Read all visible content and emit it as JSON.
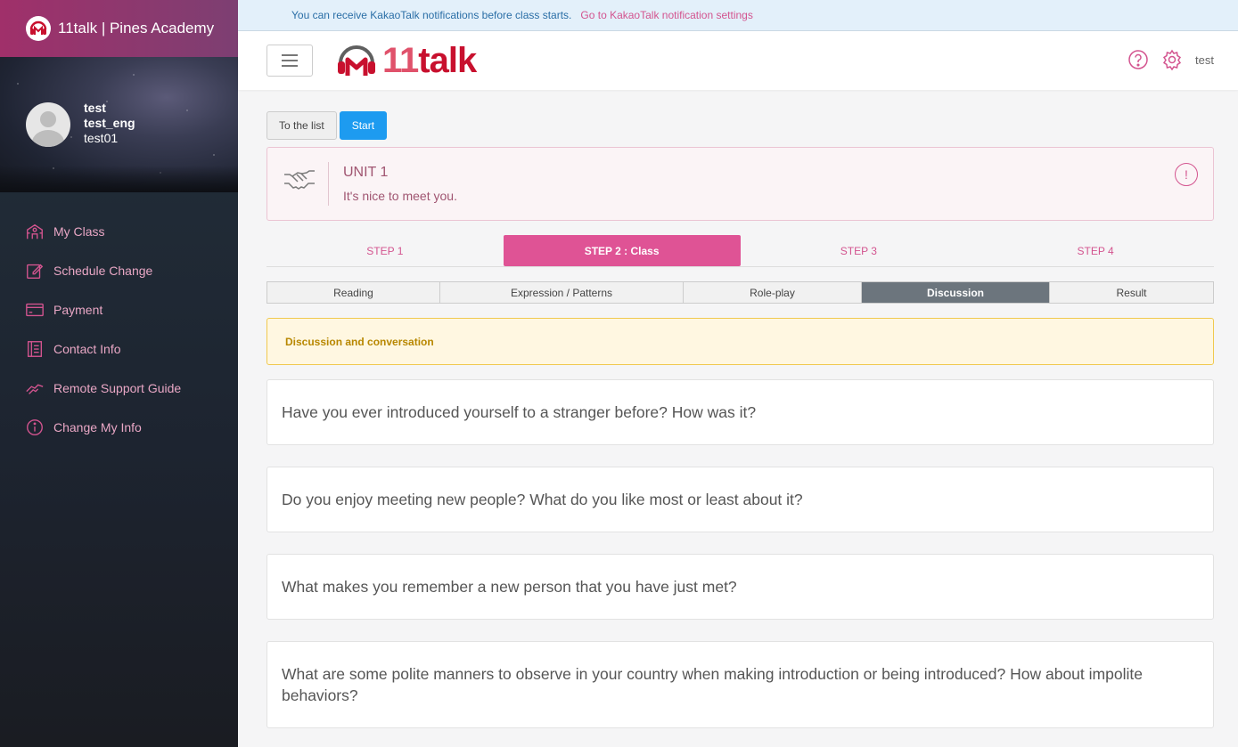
{
  "sidebar": {
    "brand": "11talk | Pines Academy",
    "profile": {
      "name": "test",
      "eng_name": "test_eng",
      "id": "test01"
    },
    "items": [
      {
        "label": "My Class",
        "icon": "school-icon"
      },
      {
        "label": "Schedule Change",
        "icon": "edit-icon"
      },
      {
        "label": "Payment",
        "icon": "card-icon"
      },
      {
        "label": "Contact Info",
        "icon": "book-icon"
      },
      {
        "label": "Remote Support Guide",
        "icon": "handshake-icon"
      },
      {
        "label": "Change My Info",
        "icon": "info-icon"
      }
    ]
  },
  "notice": {
    "text": "You can receive KakaoTalk notifications before class starts.",
    "link": "Go to KakaoTalk notification settings"
  },
  "header": {
    "logo_text_a": "11",
    "logo_text_b": "talk",
    "user": "test"
  },
  "buttons": {
    "list": "To the list",
    "start": "Start"
  },
  "unit": {
    "title": "UNIT 1",
    "subtitle": "It's nice to meet you.",
    "alert": "!"
  },
  "steps": [
    "STEP 1",
    "STEP 2 : Class",
    "STEP 3",
    "STEP 4"
  ],
  "tabs": [
    "Reading",
    "Expression / Patterns",
    "Role-play",
    "Discussion",
    "Result"
  ],
  "alert": "Discussion and conversation",
  "questions": [
    "Have you ever introduced yourself to a stranger before? How was it?",
    "Do you enjoy meeting new people? What do you like most or least about it?",
    "What makes you remember a new person that you have just met?",
    "What are some polite manners to observe in your country when making introduction or being introduced? How about impolite behaviors?"
  ],
  "colors": {
    "accent": "#df5395",
    "link": "#1d9bf0",
    "logo": "#c8102e"
  }
}
